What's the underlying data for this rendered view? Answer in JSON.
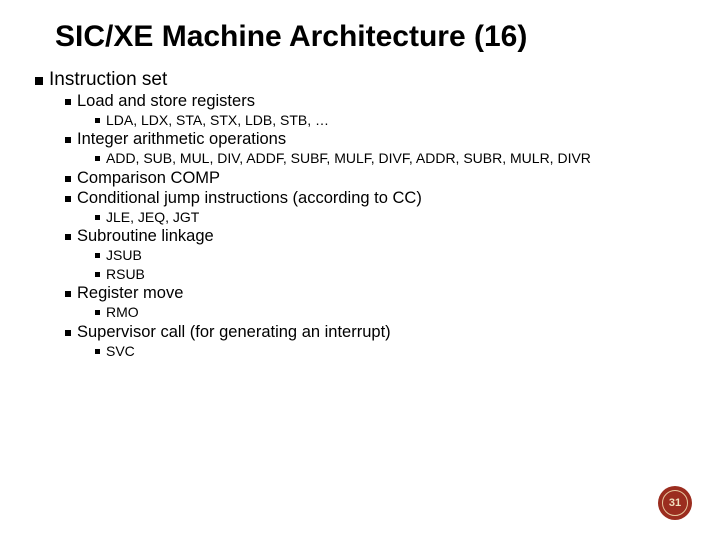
{
  "title": "SIC/XE Machine Architecture (16)",
  "lvl1": "Instruction set",
  "items": [
    {
      "label": "Load and store registers",
      "sub": [
        "LDA, LDX, STA, STX, LDB, STB, …"
      ]
    },
    {
      "label": "Integer arithmetic operations",
      "sub": [
        "ADD, SUB, MUL, DIV, ADDF, SUBF, MULF, DIVF, ADDR, SUBR, MULR, DIVR"
      ]
    },
    {
      "label": "Comparison COMP",
      "sub": []
    },
    {
      "label": "Conditional jump instructions (according to CC)",
      "sub": [
        "JLE, JEQ, JGT"
      ]
    },
    {
      "label": "Subroutine linkage",
      "sub": [
        "JSUB",
        "RSUB"
      ]
    },
    {
      "label": "Register move",
      "sub": [
        "RMO"
      ]
    },
    {
      "label": "Supervisor call (for generating an interrupt)",
      "sub": [
        "SVC"
      ]
    }
  ],
  "page_number": "31"
}
